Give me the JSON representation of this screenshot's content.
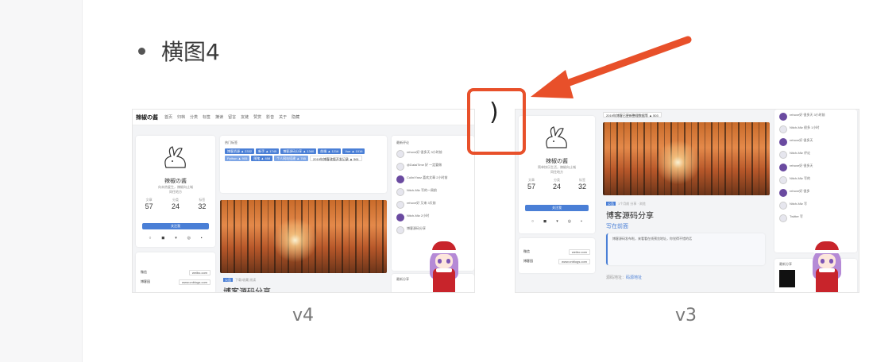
{
  "bullet": {
    "text": "横图4"
  },
  "annotation": {
    "paren": ")"
  },
  "screenshots": {
    "v4": {
      "caption": "v4",
      "site": {
        "brand": "辣椒の酱",
        "nav": [
          "首页",
          "归档",
          "分类",
          "标签",
          "摘读",
          "留言",
          "友链",
          "赞赏",
          "影音",
          "关于",
          "隐藏"
        ],
        "name": "辣椒の酱",
        "bio": "向未热爱生，辣椒向止城",
        "location": "同住地方",
        "stats": [
          {
            "label": "文章",
            "value": "57"
          },
          {
            "label": "分类",
            "value": "24"
          },
          {
            "label": "标签",
            "value": "32"
          }
        ],
        "follow": "关注我",
        "social": [
          "○",
          "◼",
          "▾",
          "◎",
          "▪"
        ],
        "links": [
          {
            "label": "微信",
            "value": "weibo.com"
          },
          {
            "label": "博客园",
            "value": "www.cnblogs.com"
          }
        ],
        "hot_tags_title": "热门标签",
        "hot_tags": [
          "博客资源 ▲ 2332",
          "新手 ▲ 1745",
          "博客源码分享 ▲ 1340",
          "前端 ▲ 1216",
          "Vue ▲ 1016",
          "Python ▲ 905",
          "随笔 ▲ 858",
          "个人网站搭建 ▲ 765",
          "2019年博客改版开发记录 ▲ 561"
        ],
        "post_badge": "公告",
        "post_meta": "下载/收藏  阅读",
        "post_title": "博客源码分享",
        "recent_title": "最新评论",
        "comments": [
          "rehove好 很多天 3小时前",
          "@DalaiTime 好 一定要做",
          "Colin/Yanz 喜欢文章 2小时前",
          "Nitch-Mtz 写的一周前",
          "rehove好 又来 3天前",
          "Nitch-Mtz 2小时",
          "博客源码分享"
        ],
        "share_title": "最新分享"
      }
    },
    "v3": {
      "caption": "v3",
      "site": {
        "top_tag": "2019年博客已更新整理数据等 ▲ 503",
        "name": "辣椒の酱",
        "bio": "简单快乐生活，辣椒向止城",
        "location": "同住地方",
        "stats": [
          {
            "label": "文章",
            "value": "57"
          },
          {
            "label": "分类",
            "value": "24"
          },
          {
            "label": "标签",
            "value": "32"
          }
        ],
        "follow": "关注我",
        "social": [
          "○",
          "◼",
          "▾",
          "◎",
          "▪"
        ],
        "links": [
          {
            "label": "微信",
            "value": "weibo.com"
          },
          {
            "label": "博客园",
            "value": "www.cnblogs.com"
          }
        ],
        "post_badge": "公告",
        "post_meta": "1个月前  分享 ·  浏览",
        "post_title": "博客源码分享",
        "intro_title": "写在前面",
        "intro_text": "博客源码发布啦，来看看在线预览地址，你觉得不错的话",
        "source_label": "源码地址：",
        "source_link": "码源地址",
        "comments": [
          "rehove好 很多天 3小时前",
          "Nitch-Mtz 很多 1小时",
          "rehove好 很多天",
          "Nitch-Mtz 评论",
          "rehove好 很多天",
          "Nitch-Mtz 写的",
          "rehove好 很多",
          "Nitch-Mtz 写",
          "Twitter 写"
        ],
        "share_title": "最新分享"
      }
    }
  },
  "colors": {
    "accent": "#4a7fd6",
    "annotation": "#e8502a"
  }
}
